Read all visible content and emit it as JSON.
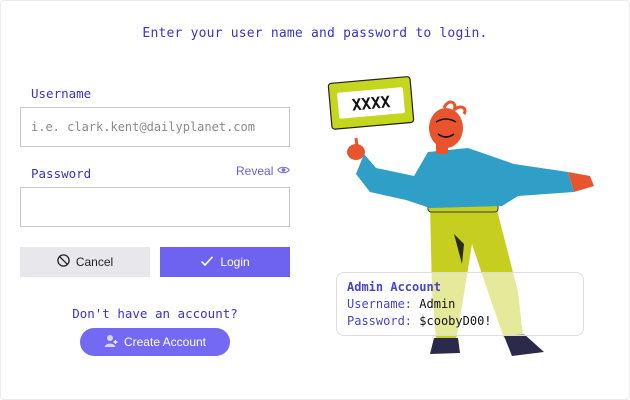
{
  "header": {
    "prompt": "Enter your user name and password to login."
  },
  "form": {
    "username_label": "Username",
    "username_placeholder": "i.e. clark.kent@dailyplanet.com",
    "username_value": "",
    "password_label": "Password",
    "password_value": "",
    "reveal_label": "Reveal",
    "cancel_label": "Cancel",
    "login_label": "Login",
    "no_account_text": "Don't have an account?",
    "create_account_label": "Create Account"
  },
  "illustration": {
    "sign_text": "XXXX"
  },
  "admin_card": {
    "title": "Admin Account",
    "username_key": "Username:",
    "username_value": "Admin",
    "password_key": "Password:",
    "password_value": "$coobyD00!"
  },
  "colors": {
    "accent": "#6e63f0",
    "text_accent": "#3b32c8",
    "sign_green": "#c5d61e",
    "shirt_blue": "#2f9fc8",
    "pants_green": "#c6cf1f",
    "skin_orange": "#e8542e"
  }
}
